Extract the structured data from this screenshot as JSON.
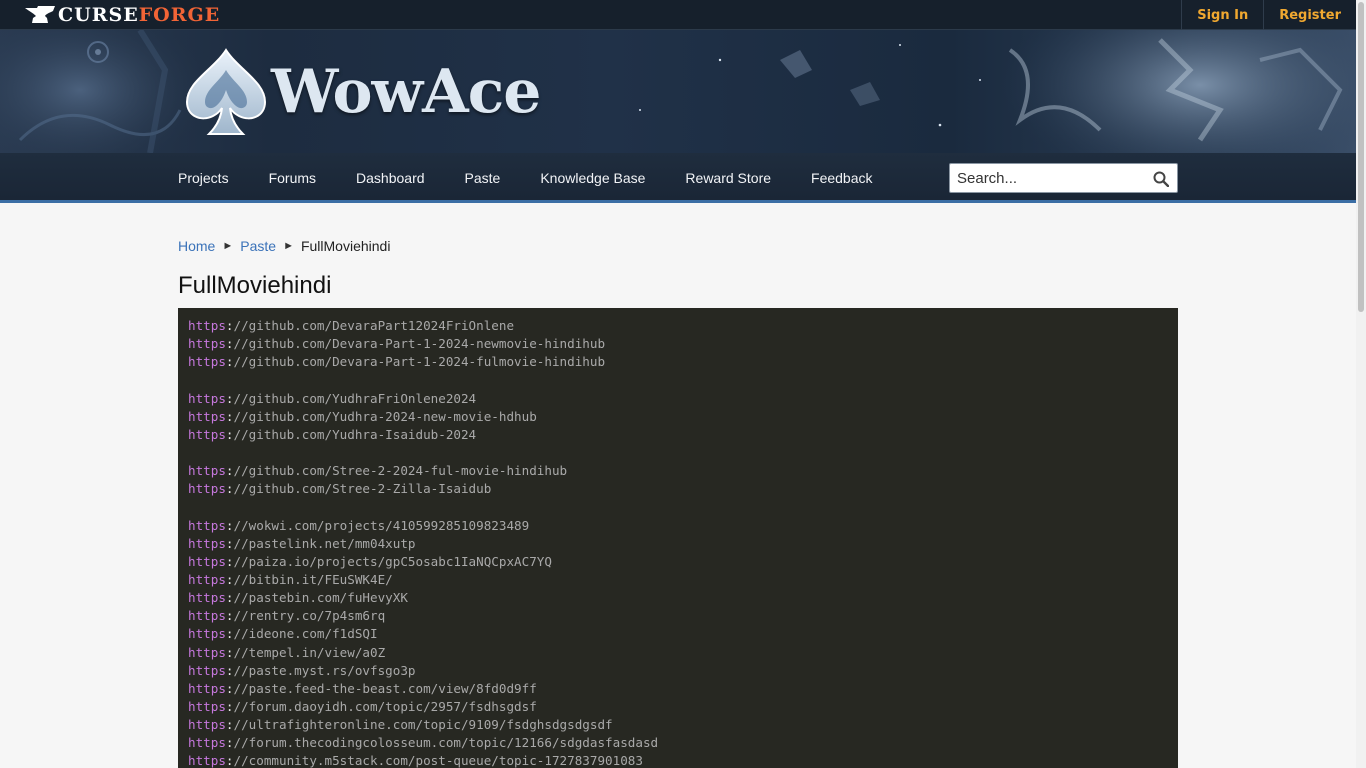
{
  "topbar": {
    "logo": {
      "part1": "CURSE",
      "part2": "FORGE",
      "icon": "anvil-icon",
      "color": "#f16436"
    },
    "links": [
      {
        "label": "Sign In"
      },
      {
        "label": "Register"
      }
    ]
  },
  "banner": {
    "site_name": "WowAce",
    "logo_icon": "spade-icon"
  },
  "nav": {
    "items": [
      {
        "label": "Projects"
      },
      {
        "label": "Forums"
      },
      {
        "label": "Dashboard"
      },
      {
        "label": "Paste"
      },
      {
        "label": "Knowledge Base"
      },
      {
        "label": "Reward Store"
      },
      {
        "label": "Feedback"
      }
    ],
    "search": {
      "placeholder": "Search...",
      "icon": "search-icon"
    }
  },
  "breadcrumb": {
    "home": "Home",
    "paste": "Paste",
    "current": "FullMoviehindi"
  },
  "page": {
    "title": "FullMoviehindi"
  },
  "paste": {
    "lines": [
      {
        "scheme": "https",
        "rest": "//github.com/DevaraPart12024FriOnlene"
      },
      {
        "scheme": "https",
        "rest": "//github.com/Devara-Part-1-2024-newmovie-hindihub"
      },
      {
        "scheme": "https",
        "rest": "//github.com/Devara-Part-1-2024-fulmovie-hindihub"
      },
      {
        "scheme": "",
        "rest": ""
      },
      {
        "scheme": "https",
        "rest": "//github.com/YudhraFriOnlene2024"
      },
      {
        "scheme": "https",
        "rest": "//github.com/Yudhra-2024-new-movie-hdhub"
      },
      {
        "scheme": "https",
        "rest": "//github.com/Yudhra-Isaidub-2024"
      },
      {
        "scheme": "",
        "rest": ""
      },
      {
        "scheme": "https",
        "rest": "//github.com/Stree-2-2024-ful-movie-hindihub"
      },
      {
        "scheme": "https",
        "rest": "//github.com/Stree-2-Zilla-Isaidub"
      },
      {
        "scheme": "",
        "rest": ""
      },
      {
        "scheme": "https",
        "rest": "//wokwi.com/projects/410599285109823489"
      },
      {
        "scheme": "https",
        "rest": "//pastelink.net/mm04xutp"
      },
      {
        "scheme": "https",
        "rest": "//paiza.io/projects/gpC5osabc1IaNQCpxAC7YQ"
      },
      {
        "scheme": "https",
        "rest": "//bitbin.it/FEuSWK4E/"
      },
      {
        "scheme": "https",
        "rest": "//pastebin.com/fuHevyXK"
      },
      {
        "scheme": "https",
        "rest": "//rentry.co/7p4sm6rq"
      },
      {
        "scheme": "https",
        "rest": "//ideone.com/f1dSQI"
      },
      {
        "scheme": "https",
        "rest": "//tempel.in/view/a0Z"
      },
      {
        "scheme": "https",
        "rest": "//paste.myst.rs/ovfsgo3p"
      },
      {
        "scheme": "https",
        "rest": "//paste.feed-the-beast.com/view/8fd0d9ff"
      },
      {
        "scheme": "https",
        "rest": "//forum.daoyidh.com/topic/2957/fsdhsgdsf"
      },
      {
        "scheme": "https",
        "rest": "//ultrafighteronline.com/topic/9109/fsdghsdgsdgsdf"
      },
      {
        "scheme": "https",
        "rest": "//forum.thecodingcolosseum.com/topic/12166/sdgdasfasdasd"
      },
      {
        "scheme": "https",
        "rest": "//community.m5stack.com/post-queue/topic-1727837901083"
      }
    ]
  }
}
